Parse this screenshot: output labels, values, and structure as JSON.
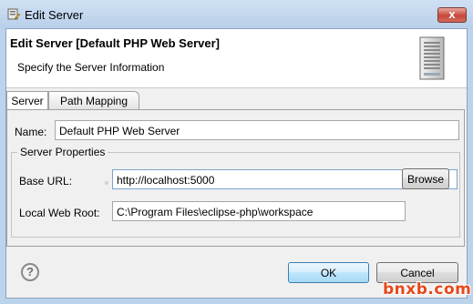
{
  "window": {
    "title": "Edit Server",
    "close_glyph": "x"
  },
  "header": {
    "title": "Edit Server [Default PHP Web Server]",
    "subtitle": "Specify the Server Information",
    "icon": "server-icon"
  },
  "tabs": [
    {
      "label": "Server",
      "selected": true
    },
    {
      "label": "Path Mapping",
      "selected": false
    }
  ],
  "form": {
    "name_label": "Name:",
    "name_value": "Default PHP Web Server",
    "group_label": "Server Properties",
    "base_url_label": "Base URL:",
    "base_url_value": "http://localhost:5000",
    "web_root_label": "Local Web Root:",
    "web_root_value": "C:\\Program Files\\eclipse-php\\workspace",
    "browse_label": "Browse"
  },
  "footer": {
    "help_glyph": "?",
    "ok_label": "OK",
    "cancel_label": "Cancel"
  },
  "watermark": "bnxb.com",
  "colors": {
    "frame": "#bcd3ec",
    "close": "#c7473a",
    "ok_border": "#3c7fb1",
    "watermark": "#e8481b"
  }
}
